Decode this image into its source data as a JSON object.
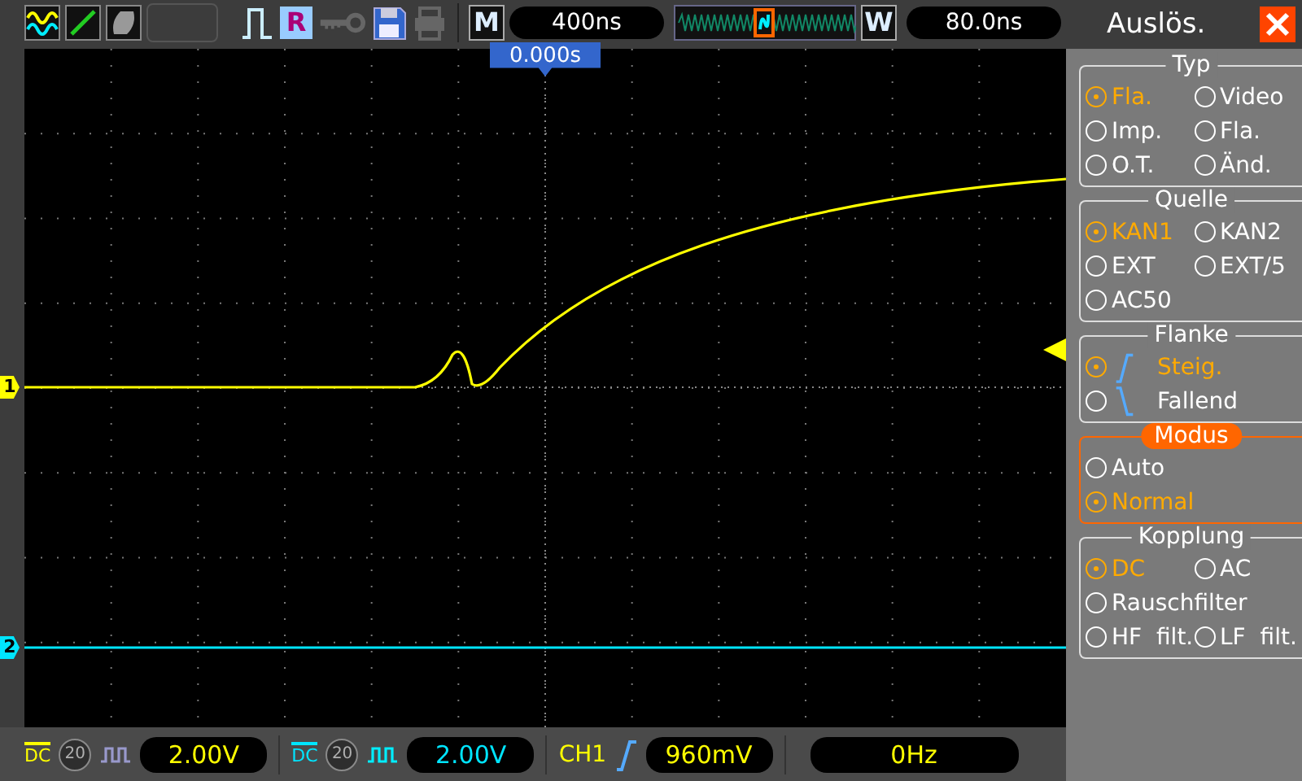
{
  "toolbar": {
    "run_label": "R",
    "menu_label": "M",
    "time_base": "400ns",
    "zoom_label": "W",
    "delay": "80.0ns"
  },
  "scope": {
    "trigger_position": "0.000s",
    "channel_markers": [
      {
        "label": "1",
        "color": "#ffff00"
      },
      {
        "label": "2",
        "color": "#00e5ff"
      }
    ]
  },
  "panel": {
    "title": "Auslös.",
    "sections": [
      {
        "title": "Typ",
        "highlighted": false,
        "options": [
          {
            "label": "Fla.",
            "selected": true,
            "kind": "radio",
            "wide": false
          },
          {
            "label": "Video",
            "selected": false,
            "kind": "radio",
            "wide": false
          },
          {
            "label": "Imp.",
            "selected": false,
            "kind": "radio",
            "wide": false
          },
          {
            "label": "Fla.",
            "selected": false,
            "kind": "radio",
            "wide": false
          },
          {
            "label": "O.T.",
            "selected": false,
            "kind": "radio",
            "wide": false
          },
          {
            "label": "Änd.",
            "selected": false,
            "kind": "radio",
            "wide": false
          }
        ]
      },
      {
        "title": "Quelle",
        "highlighted": false,
        "options": [
          {
            "label": "KAN1",
            "selected": true,
            "kind": "radio",
            "wide": false
          },
          {
            "label": "KAN2",
            "selected": false,
            "kind": "radio",
            "wide": false
          },
          {
            "label": "EXT",
            "selected": false,
            "kind": "radio",
            "wide": false
          },
          {
            "label": "EXT/5",
            "selected": false,
            "kind": "radio",
            "wide": false
          },
          {
            "label": "AC50",
            "selected": false,
            "kind": "radio",
            "wide": true
          }
        ]
      },
      {
        "title": "Flanke",
        "highlighted": false,
        "options": [
          {
            "label": "Steig.",
            "selected": true,
            "kind": "rising",
            "wide": true
          },
          {
            "label": "Fallend",
            "selected": false,
            "kind": "falling",
            "wide": true
          }
        ]
      },
      {
        "title": "Modus",
        "highlighted": true,
        "options": [
          {
            "label": "Auto",
            "selected": false,
            "kind": "radio",
            "wide": true
          },
          {
            "label": "Normal",
            "selected": true,
            "kind": "radio",
            "wide": true
          }
        ]
      },
      {
        "title": "Kopplung",
        "highlighted": false,
        "options": [
          {
            "label": "DC",
            "selected": true,
            "kind": "radio",
            "wide": false
          },
          {
            "label": "AC",
            "selected": false,
            "kind": "radio",
            "wide": false
          },
          {
            "label": "Rauschfilter",
            "selected": false,
            "kind": "radio",
            "wide": true
          },
          {
            "label": "HF  filt.",
            "selected": false,
            "kind": "radio",
            "wide": false
          },
          {
            "label": "LF  filt.",
            "selected": false,
            "kind": "radio",
            "wide": false
          }
        ]
      }
    ]
  },
  "status_bar": {
    "channels": [
      {
        "coupling": "DC",
        "bw_limit": {
          "label": "20",
          "on": false
        },
        "scale": "2.00V",
        "color": "#ffff00"
      },
      {
        "coupling": "DC",
        "bw_limit": {
          "label": "20",
          "on": false
        },
        "scale": "2.00V",
        "color": "#00e5ff"
      }
    ],
    "trigger": {
      "source": "CH1",
      "level": "960mV"
    },
    "frequency": "0Hz"
  }
}
